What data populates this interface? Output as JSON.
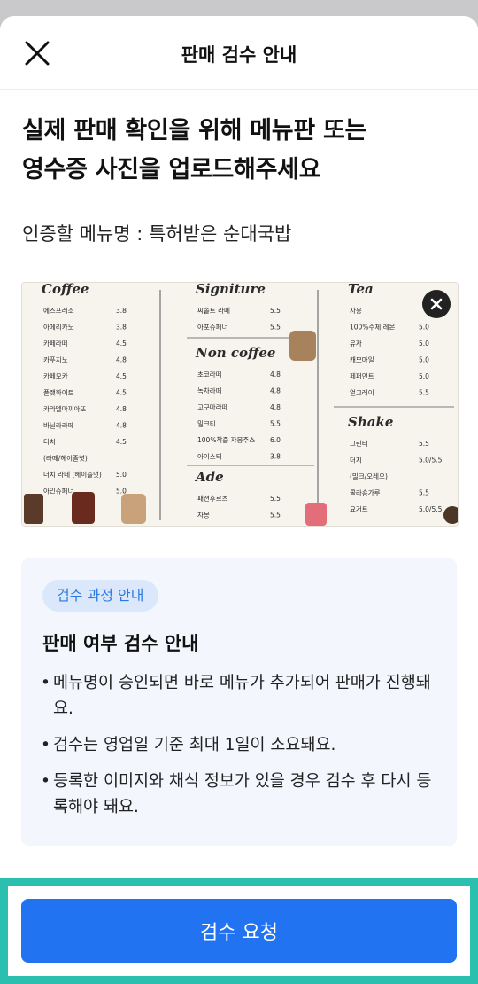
{
  "header": {
    "title": "판매 검수 안내",
    "close_icon": "close-icon"
  },
  "headline": "실제 판매 확인을 위해 메뉴판 또는\n영수증 사진을 업로드해주세요",
  "menu_name": {
    "label": "인증할 메뉴명 :",
    "value": "특허받은 순대국밥"
  },
  "photo": {
    "alt": "cafe menu board photo",
    "remove_icon": "remove-photo-icon",
    "sections": [
      {
        "title": "Coffee",
        "items": [
          {
            "name": "에스프레소",
            "price": "3.8"
          },
          {
            "name": "아메리카노",
            "price": "3.8"
          },
          {
            "name": "카페라떼",
            "price": "4.5"
          },
          {
            "name": "카푸치노",
            "price": "4.8"
          },
          {
            "name": "카페모카",
            "price": "4.5"
          },
          {
            "name": "플랫화이트",
            "price": "4.5"
          },
          {
            "name": "카라멜마끼아또",
            "price": "4.8"
          },
          {
            "name": "바닐라라떼",
            "price": "4.8"
          },
          {
            "name": "더치",
            "price": "4.5"
          },
          {
            "name": "(라떼/헤이즐넛)",
            "price": ""
          },
          {
            "name": "더치 라떼 (헤이즐넛)",
            "price": "5.0"
          },
          {
            "name": "아인슈페너",
            "price": "5.0"
          }
        ]
      },
      {
        "title": "Signiture",
        "items": [
          {
            "name": "씨솔트 라떼",
            "price": "5.5"
          },
          {
            "name": "아포슈페너",
            "price": "5.5"
          }
        ]
      },
      {
        "title": "Non coffee",
        "items": [
          {
            "name": "초코라떼",
            "price": "4.8"
          },
          {
            "name": "녹차라떼",
            "price": "4.8"
          },
          {
            "name": "고구마라떼",
            "price": "4.8"
          },
          {
            "name": "밀크티",
            "price": "5.5"
          },
          {
            "name": "100%착즙 자몽주스",
            "price": "6.0"
          },
          {
            "name": "아이스티",
            "price": "3.8"
          }
        ]
      },
      {
        "title": "Ade",
        "items": [
          {
            "name": "패션후르츠",
            "price": "5.5"
          },
          {
            "name": "자몽",
            "price": "5.5"
          }
        ]
      },
      {
        "title": "Tea",
        "items": [
          {
            "name": "자몽",
            "price": ""
          },
          {
            "name": "100%수제 레몬",
            "price": "5.0"
          },
          {
            "name": "유자",
            "price": "5.0"
          },
          {
            "name": "캐모마일",
            "price": "5.0"
          },
          {
            "name": "페퍼민트",
            "price": "5.0"
          },
          {
            "name": "얼그레이",
            "price": "5.5"
          }
        ]
      },
      {
        "title": "Shake",
        "items": [
          {
            "name": "그린티",
            "price": "5.5"
          },
          {
            "name": "더치",
            "price": "5.0/5.5"
          },
          {
            "name": "(밀크/오레오)",
            "price": ""
          },
          {
            "name": "콜라숑가루",
            "price": "5.5"
          },
          {
            "name": "요거트",
            "price": "5.0/5.5"
          },
          {
            "name": "(플레인/딸기)",
            "price": ""
          }
        ]
      }
    ]
  },
  "info": {
    "chip": "검수 과정 안내",
    "title": "판매 여부 검수 안내",
    "bullets": [
      "메뉴명이 승인되면 바로 메뉴가 추가되어 판매가 진행돼요.",
      "검수는 영업일 기준 최대 1일이 소요돼요.",
      "등록한 이미지와 채식 정보가 있을 경우 검수 후 다시 등록해야 돼요."
    ]
  },
  "footer": {
    "submit_label": "검수 요청"
  },
  "colors": {
    "primary": "#2173f2",
    "chip_bg": "#dbe8fb",
    "chip_text": "#2a7ae0",
    "card_bg": "#f3f6fc",
    "highlight": "#2bbfb0"
  }
}
